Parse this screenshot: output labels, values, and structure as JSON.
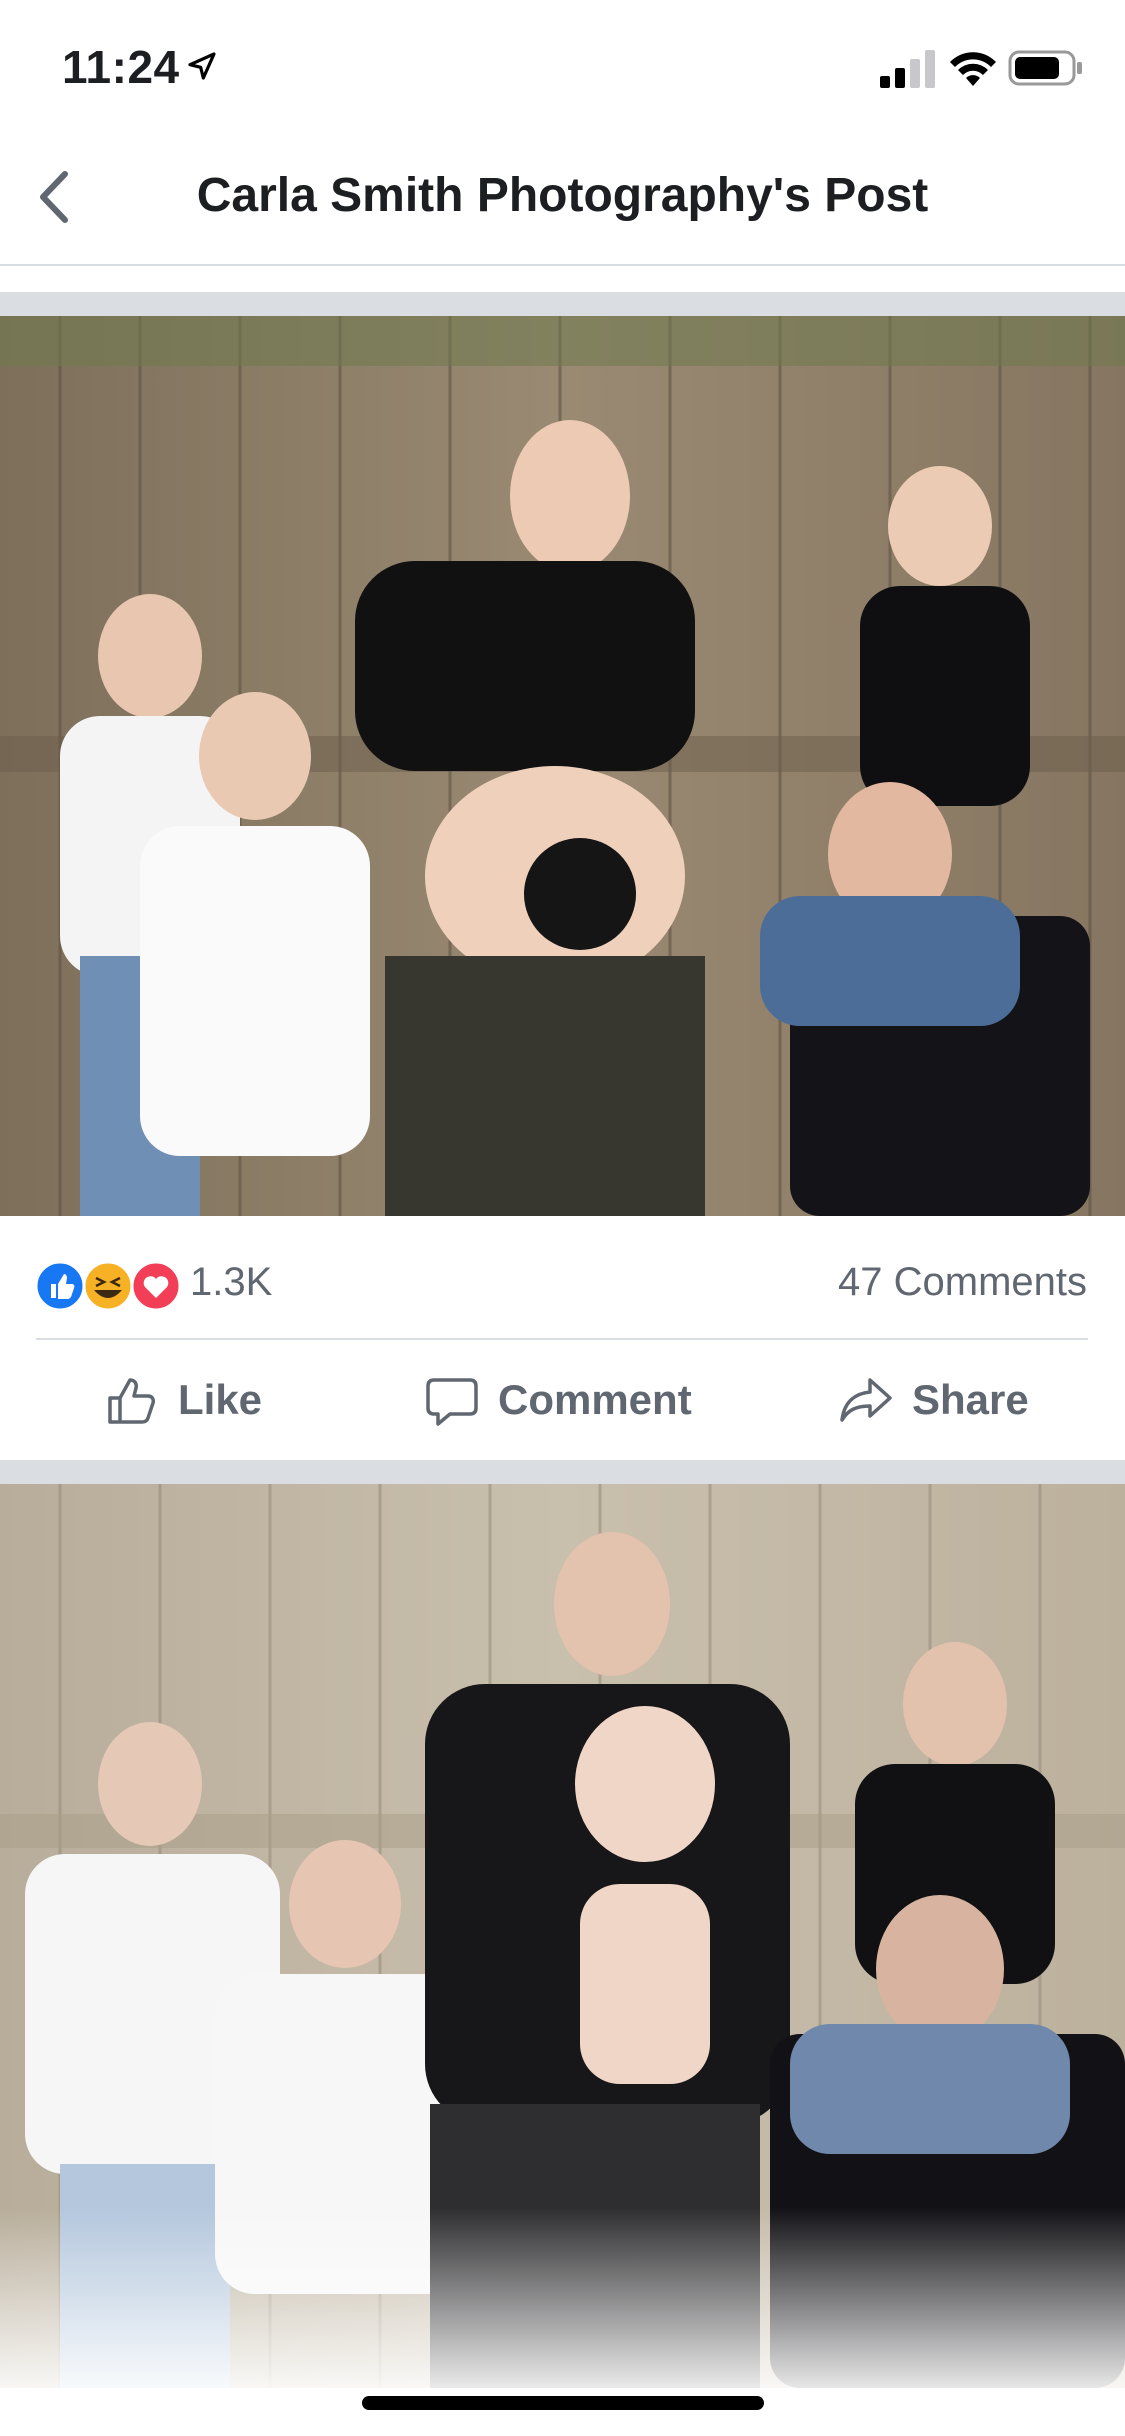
{
  "status_bar": {
    "time": "11:24"
  },
  "nav": {
    "title": "Carla Smith Photography's Post",
    "back_icon": "chevron-left-icon"
  },
  "post1": {
    "reactions": {
      "icons": [
        "like-reaction-icon",
        "haha-reaction-icon",
        "love-reaction-icon"
      ],
      "count": "1.3K"
    },
    "comments": "47 Comments",
    "actions": {
      "like": "Like",
      "comment": "Comment",
      "share": "Share"
    }
  },
  "colors": {
    "brand_blue": "#1877f2",
    "text_secondary": "#606770",
    "separator": "#dadde1"
  }
}
